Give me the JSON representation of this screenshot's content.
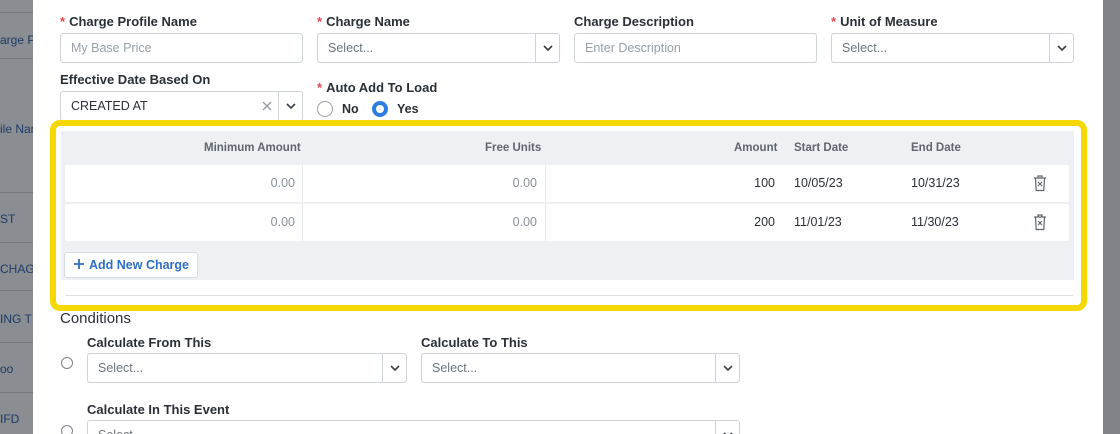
{
  "background": {
    "items": [
      "arge P",
      "ile Nam",
      "ST",
      "CHAGE",
      "ING T",
      "oo",
      "IFD"
    ]
  },
  "form": {
    "charge_profile_name": {
      "label": "Charge Profile Name",
      "placeholder": "My Base Price",
      "required": true
    },
    "charge_name": {
      "label": "Charge Name",
      "value": "Select...",
      "required": true
    },
    "charge_description": {
      "label": "Charge Description",
      "placeholder": "Enter Description"
    },
    "unit_of_measure": {
      "label": "Unit of Measure",
      "value": "Select...",
      "required": true
    },
    "effective_date": {
      "label": "Effective Date Based On",
      "value": "CREATED AT"
    },
    "auto_add": {
      "label": "Auto Add To Load",
      "required": true,
      "options": [
        {
          "label": "No",
          "selected": false
        },
        {
          "label": "Yes",
          "selected": true
        }
      ]
    },
    "required_mark": "*"
  },
  "charges_table": {
    "headers": [
      "Minimum Amount",
      "Free Units",
      "Amount",
      "Start Date",
      "End Date"
    ],
    "rows": [
      {
        "min_amount": "0.00",
        "free_units": "0.00",
        "amount": "100",
        "start": "10/05/23",
        "end": "10/31/23"
      },
      {
        "min_amount": "0.00",
        "free_units": "0.00",
        "amount": "200",
        "start": "11/01/23",
        "end": "11/30/23"
      }
    ],
    "add_label": "Add New Charge",
    "highlight_color": "#f5d800"
  },
  "conditions": {
    "title": "Conditions",
    "calc_from": {
      "label": "Calculate From This",
      "value": "Select..."
    },
    "calc_to": {
      "label": "Calculate To This",
      "value": "Select..."
    },
    "calc_event": {
      "label": "Calculate In This Event",
      "value": "Select..."
    }
  },
  "colors": {
    "accent": "#2f7de1",
    "required": "#e5484d",
    "link": "#2f6fc4"
  }
}
